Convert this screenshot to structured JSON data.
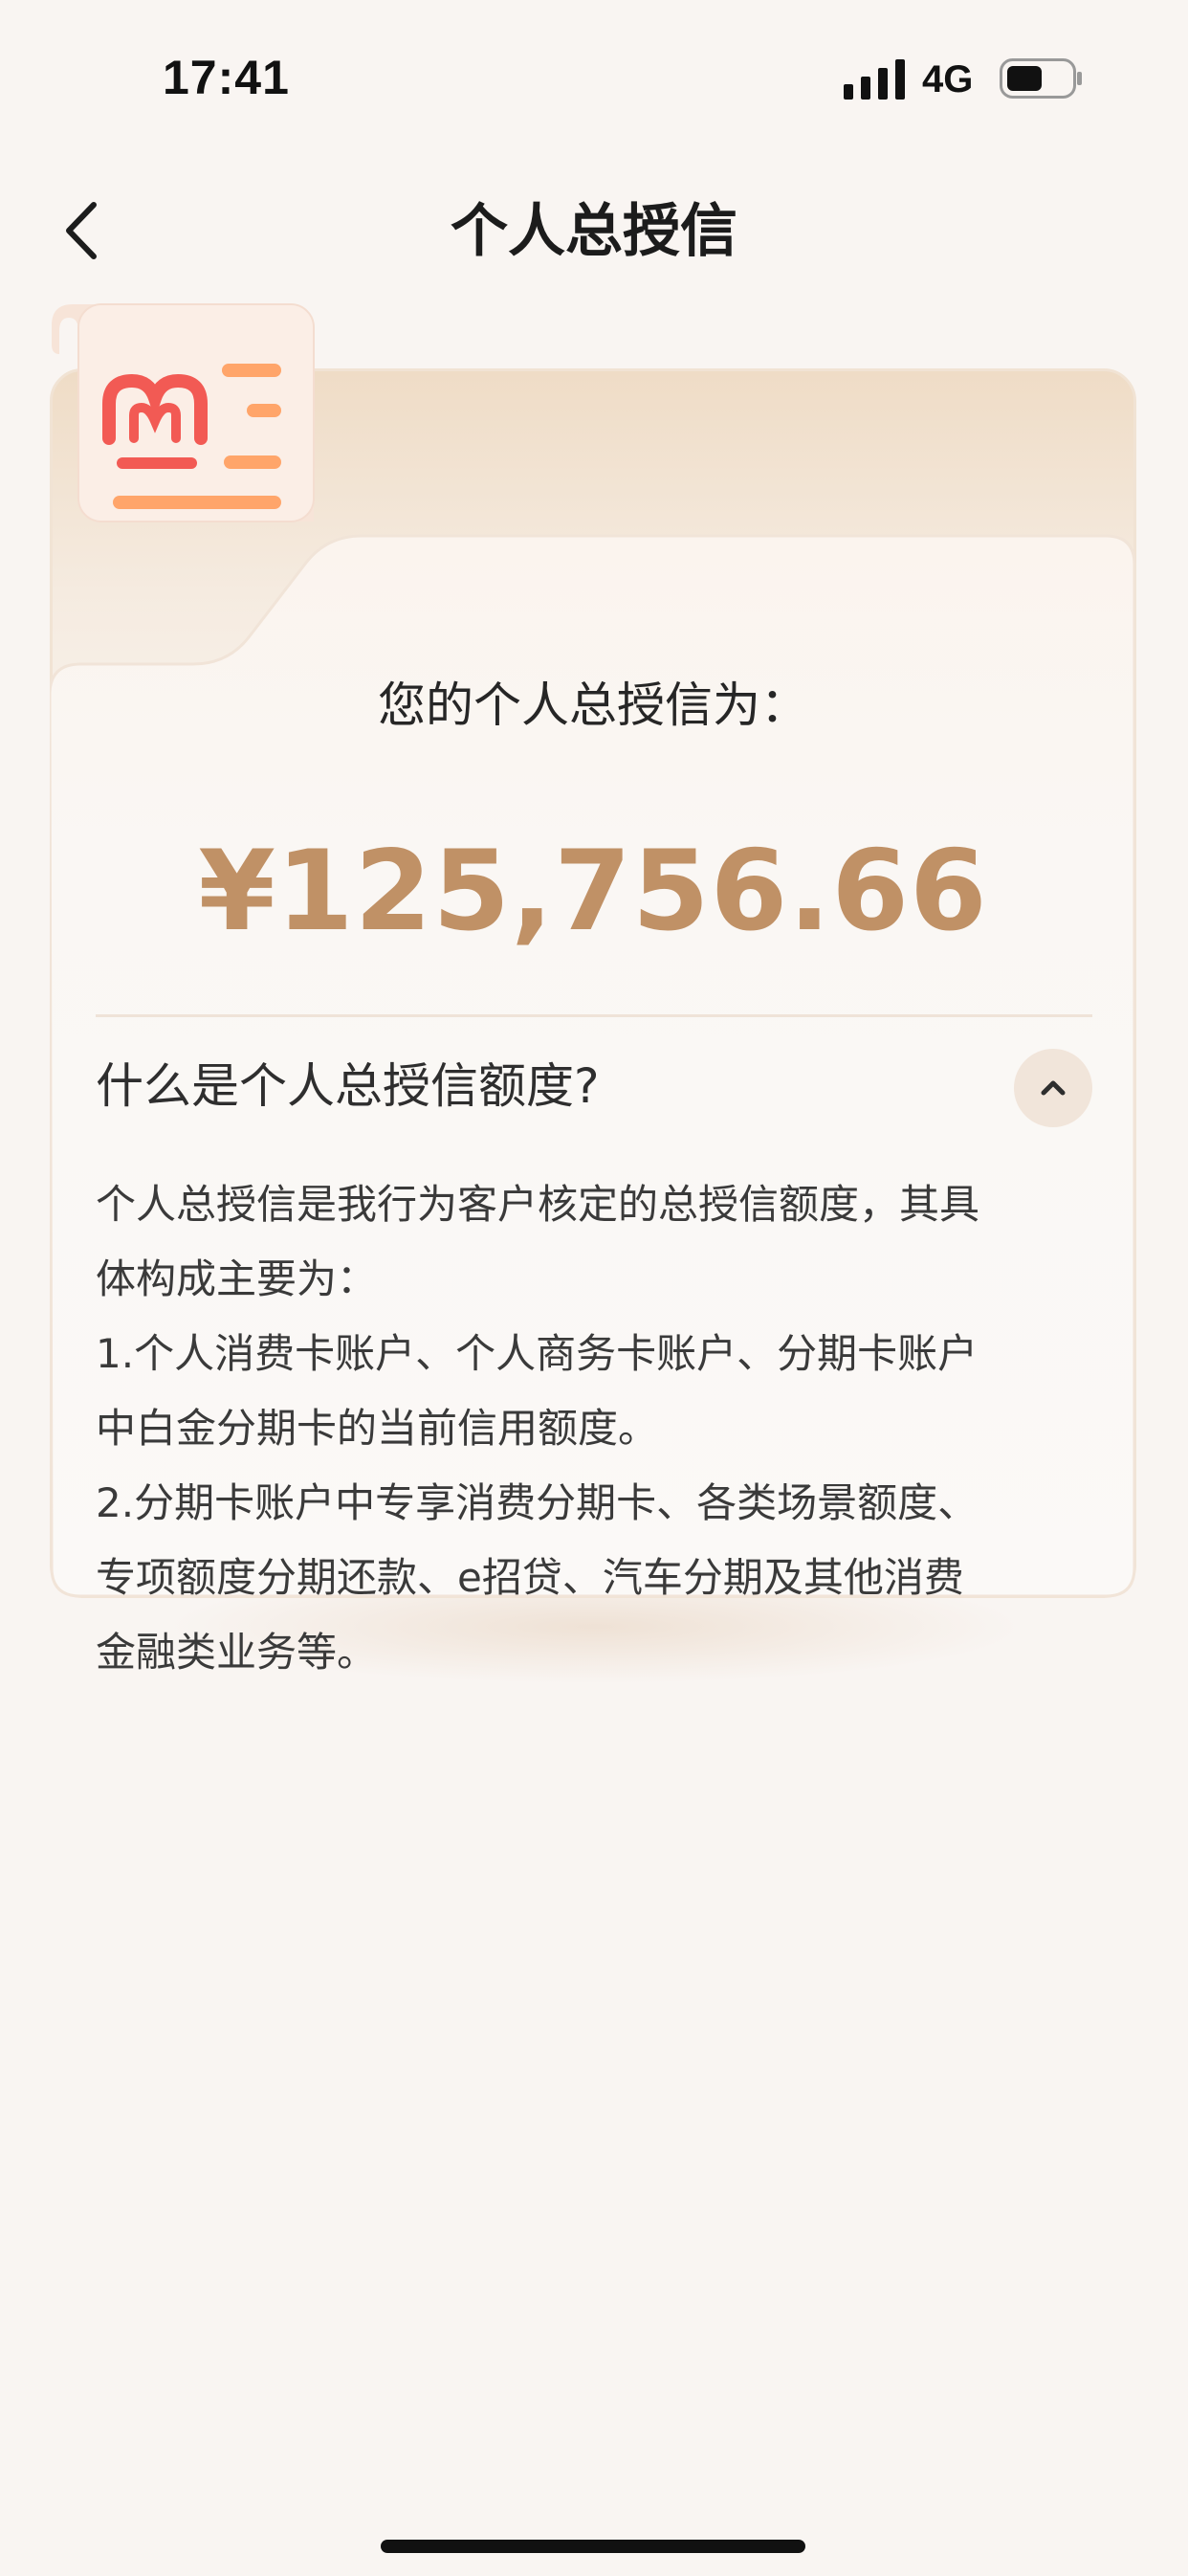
{
  "status_bar": {
    "time": "17:41",
    "network": "4G",
    "icons": [
      "signal-icon",
      "battery-icon"
    ]
  },
  "nav": {
    "title": "个人总授信",
    "back_icon": "chevron-left-icon"
  },
  "card": {
    "icon": "receipt-logo-icon",
    "label": "您的个人总授信为：",
    "amount": "¥125,756.66",
    "accent_color": "#c09166",
    "faq": {
      "question": "什么是个人总授信额度?",
      "toggle_icon": "chevron-up-icon",
      "answer_lines": [
        "个人总授信是我行为客户核定的总授信额度，其具",
        "体构成主要为：",
        "1.个人消费卡账户、个人商务卡账户、分期卡账户",
        "中白金分期卡的当前信用额度。",
        "2.分期卡账户中专享消费分期卡、各类场景额度、",
        "专项额度分期还款、e招贷、汽车分期及其他消费",
        "金融类业务等。"
      ]
    }
  }
}
